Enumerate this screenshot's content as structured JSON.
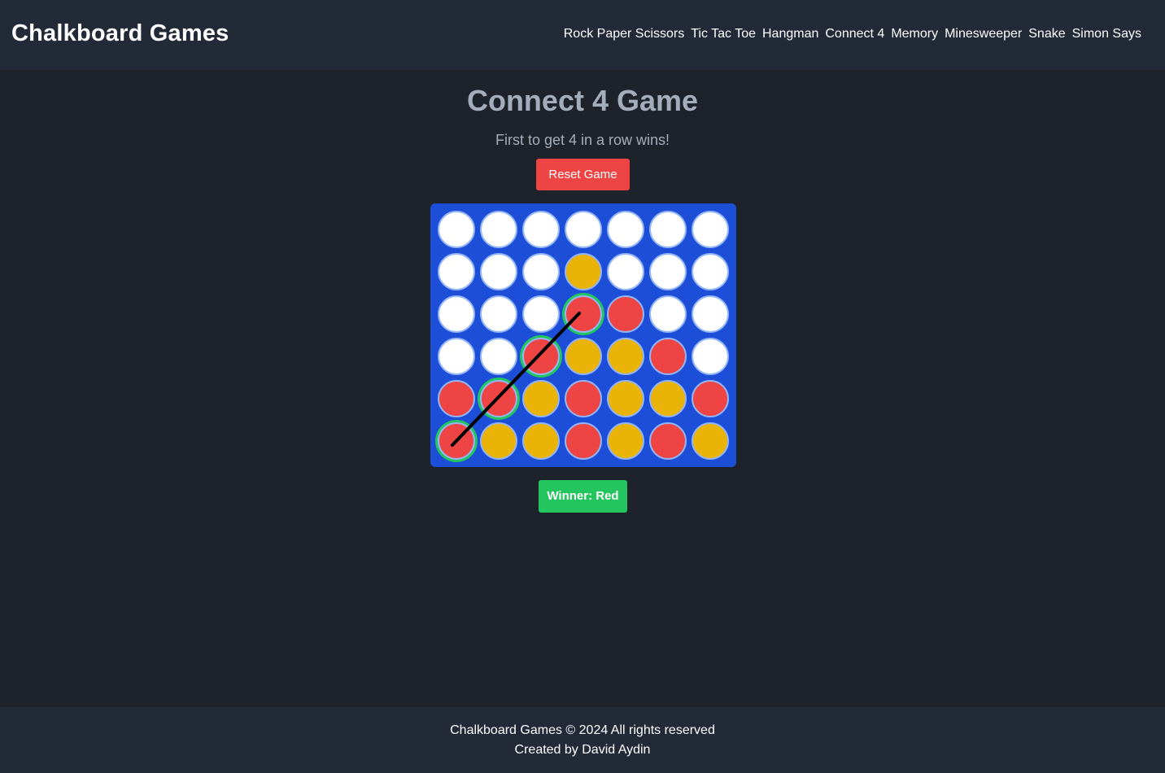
{
  "header": {
    "brand": "Chalkboard Games",
    "nav": [
      {
        "label": "Rock Paper Scissors"
      },
      {
        "label": "Tic Tac Toe"
      },
      {
        "label": "Hangman"
      },
      {
        "label": "Connect 4"
      },
      {
        "label": "Memory"
      },
      {
        "label": "Minesweeper"
      },
      {
        "label": "Snake"
      },
      {
        "label": "Simon Says"
      }
    ]
  },
  "main": {
    "title": "Connect 4 Game",
    "subtitle": "First to get 4 in a row wins!",
    "reset_label": "Reset Game",
    "winner_text": "Winner: Red"
  },
  "board": {
    "rows": 6,
    "cols": 7,
    "grid": [
      [
        "empty",
        "empty",
        "empty",
        "empty",
        "empty",
        "empty",
        "empty"
      ],
      [
        "empty",
        "empty",
        "empty",
        "yellow",
        "empty",
        "empty",
        "empty"
      ],
      [
        "empty",
        "empty",
        "empty",
        "red",
        "red",
        "empty",
        "empty"
      ],
      [
        "empty",
        "empty",
        "red",
        "yellow",
        "yellow",
        "red",
        "empty"
      ],
      [
        "red",
        "red",
        "yellow",
        "red",
        "yellow",
        "yellow",
        "red"
      ],
      [
        "red",
        "yellow",
        "yellow",
        "red",
        "yellow",
        "red",
        "yellow"
      ]
    ],
    "winning_cells": [
      [
        5,
        0
      ],
      [
        4,
        1
      ],
      [
        3,
        2
      ],
      [
        2,
        3
      ]
    ],
    "colors": {
      "board": "#1d4ed8",
      "empty": "#ffffff",
      "red": "#ef4444",
      "yellow": "#eab308",
      "highlight": "#22c55e"
    }
  },
  "footer": {
    "line1": "Chalkboard Games © 2024 All rights reserved",
    "line2": "Created by David Aydin"
  }
}
